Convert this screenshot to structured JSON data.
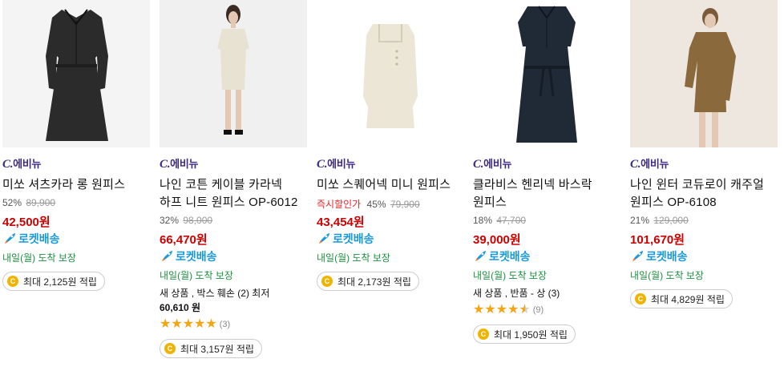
{
  "products": [
    {
      "brand_prefix": "C.",
      "brand_name": "에비뉴",
      "title": "미쏘 셔츠카라 롱 원피스",
      "instant_label": "",
      "discount": "52%",
      "original_price": "89,900",
      "sale_price": "42,500원",
      "rocket_label": "로켓배송",
      "delivery": "내일(월) 도착 보장",
      "used_text": "",
      "used_price": "",
      "rating": 0,
      "review_count": "",
      "reward": "최대 2,125원 적립",
      "coin_icon": "coin-icon",
      "garment_color": "#2b2b2b",
      "bg": "#f4f4f4"
    },
    {
      "brand_prefix": "C.",
      "brand_name": "에비뉴",
      "title": "나인 코튼 케이블 카라넥 하프 니트 원피스 OP-6012",
      "instant_label": "",
      "discount": "32%",
      "original_price": "98,000",
      "sale_price": "66,470원",
      "rocket_label": "로켓배송",
      "delivery": "내일(월) 도착 보장",
      "used_text": "새 상품 , 박스 훼손 (2) 최저",
      "used_price": "60,610 원",
      "rating": 5,
      "review_count": "(3)",
      "reward": "최대 3,157원 적립",
      "coin_icon": "coin-icon",
      "garment_color": "#e8e2d2",
      "bg": "#f0f0f0"
    },
    {
      "brand_prefix": "C.",
      "brand_name": "에비뉴",
      "title": "미쏘 스퀘어넥 미니 원피스",
      "instant_label": "즉시할인가",
      "discount": "45%",
      "original_price": "79,900",
      "sale_price": "43,454원",
      "rocket_label": "로켓배송",
      "delivery": "내일(월) 도착 보장",
      "used_text": "",
      "used_price": "",
      "rating": 0,
      "review_count": "",
      "reward": "최대 2,173원 적립",
      "coin_icon": "coin-icon",
      "garment_color": "#ebe6d6",
      "bg": "#ffffff"
    },
    {
      "brand_prefix": "C.",
      "brand_name": "에비뉴",
      "title": "클라비스 헨리넥 바스락 원피스",
      "instant_label": "",
      "discount": "18%",
      "original_price": "47,700",
      "sale_price": "39,000원",
      "rocket_label": "로켓배송",
      "delivery": "내일(월) 도착 보장",
      "used_text": "새 상품 , 반품 - 상 (3)",
      "used_price": "",
      "rating": 4.5,
      "review_count": "(9)",
      "reward": "최대 1,950원 적립",
      "coin_icon": "coin-icon",
      "garment_color": "#1f2a36",
      "bg": "#ffffff"
    },
    {
      "brand_prefix": "C.",
      "brand_name": "에비뉴",
      "title": "나인 윈터 코듀로이 캐주얼 원피스 OP-6108",
      "instant_label": "",
      "discount": "21%",
      "original_price": "129,000",
      "sale_price": "101,670원",
      "rocket_label": "로켓배송",
      "delivery": "내일(월) 도착 보장",
      "used_text": "",
      "used_price": "",
      "rating": 0,
      "review_count": "",
      "reward": "최대 4,829원 적립",
      "coin_icon": "coin-icon",
      "garment_color": "#8a6a3c",
      "bg": "#ede7df"
    }
  ],
  "colors": {
    "sale_price": "#cc0000",
    "rocket": "#1a9adb",
    "delivery": "#1d8f3f",
    "brand": "#3b2a80",
    "star": "#f3a514",
    "instant": "#e52628"
  },
  "icons": {
    "rocket": "rocket-icon",
    "coin": "coin-icon",
    "star": "star-icon"
  }
}
